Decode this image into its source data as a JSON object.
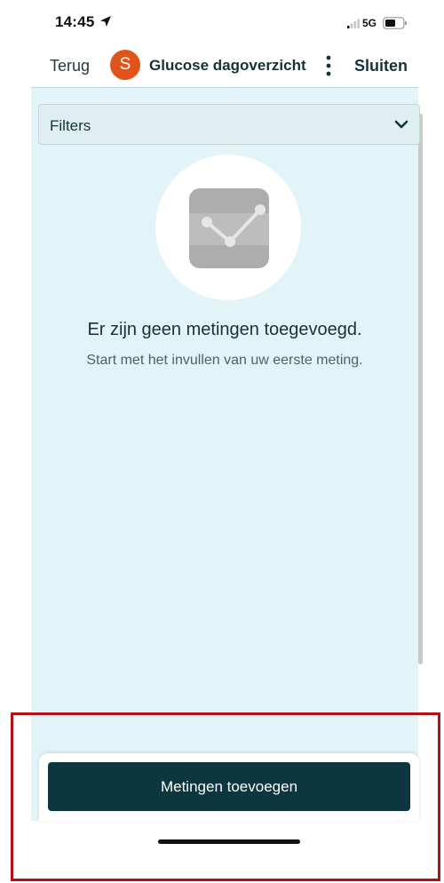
{
  "status_bar": {
    "time": "14:45",
    "network": "5G",
    "location_icon": "location-arrow-icon",
    "signal_icon": "signal-bars-icon",
    "battery_icon": "battery-icon"
  },
  "nav": {
    "back_label": "Terug",
    "avatar_letter": "S",
    "title": "Glucose dagoverzicht",
    "more_icon": "more-vertical-icon",
    "close_label": "Sluiten"
  },
  "filters": {
    "label": "Filters",
    "icon": "chevron-down-icon"
  },
  "empty_state": {
    "icon": "line-chart-icon",
    "title": "Er zijn geen metingen toegevoegd.",
    "subtitle": "Start met het invullen van uw eerste meting."
  },
  "actions": {
    "add_label": "Metingen toevoegen"
  },
  "colors": {
    "avatar": "#e0541c",
    "content_background": "#e3f4f9",
    "primary_button": "#0d3740",
    "highlight": "#b3111a"
  }
}
